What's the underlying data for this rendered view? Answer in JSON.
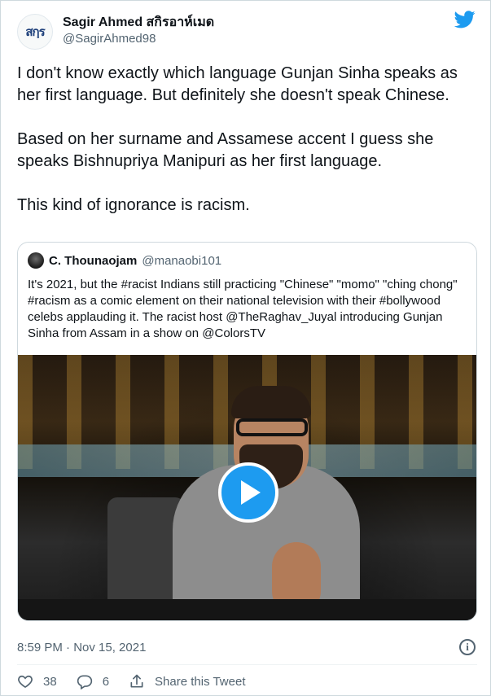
{
  "author": {
    "avatar_text": "สกฺร",
    "display_name": "Sagir Ahmed สกิรอาห์เมด",
    "handle": "@SagirAhmed98"
  },
  "brand_icon": "twitter-bird-icon",
  "tweet": {
    "paragraphs": [
      "I don't know exactly which language Gunjan Sinha speaks as her first language. But definitely she doesn't speak Chinese.",
      "Based on her surname and Assamese accent I guess she speaks Bishnupriya Manipuri as her first language.",
      "This kind of ignorance is racism."
    ]
  },
  "quoted_tweet": {
    "display_name": "C. Thounaojam",
    "handle": "@manaobi101",
    "text": "It's 2021, but the #racist Indians still practicing \"Chinese\" \"momo\" \"ching chong\" #racism as a comic element on their national television with their #bollywood celebs applauding it. The racist host @TheRaghav_Juyal introducing Gunjan Sinha from Assam in a show on @ColorsTV",
    "media": {
      "type": "video",
      "play_icon": "play-icon"
    }
  },
  "meta": {
    "timestamp": "8:59 PM · Nov 15, 2021",
    "info_icon": "info-icon"
  },
  "actions": {
    "likes": "38",
    "replies": "6",
    "share_label": "Share this Tweet"
  },
  "colors": {
    "accent": "#1d9bf0",
    "text": "#0f1419",
    "secondary": "#536471",
    "border": "#cfd9de"
  }
}
